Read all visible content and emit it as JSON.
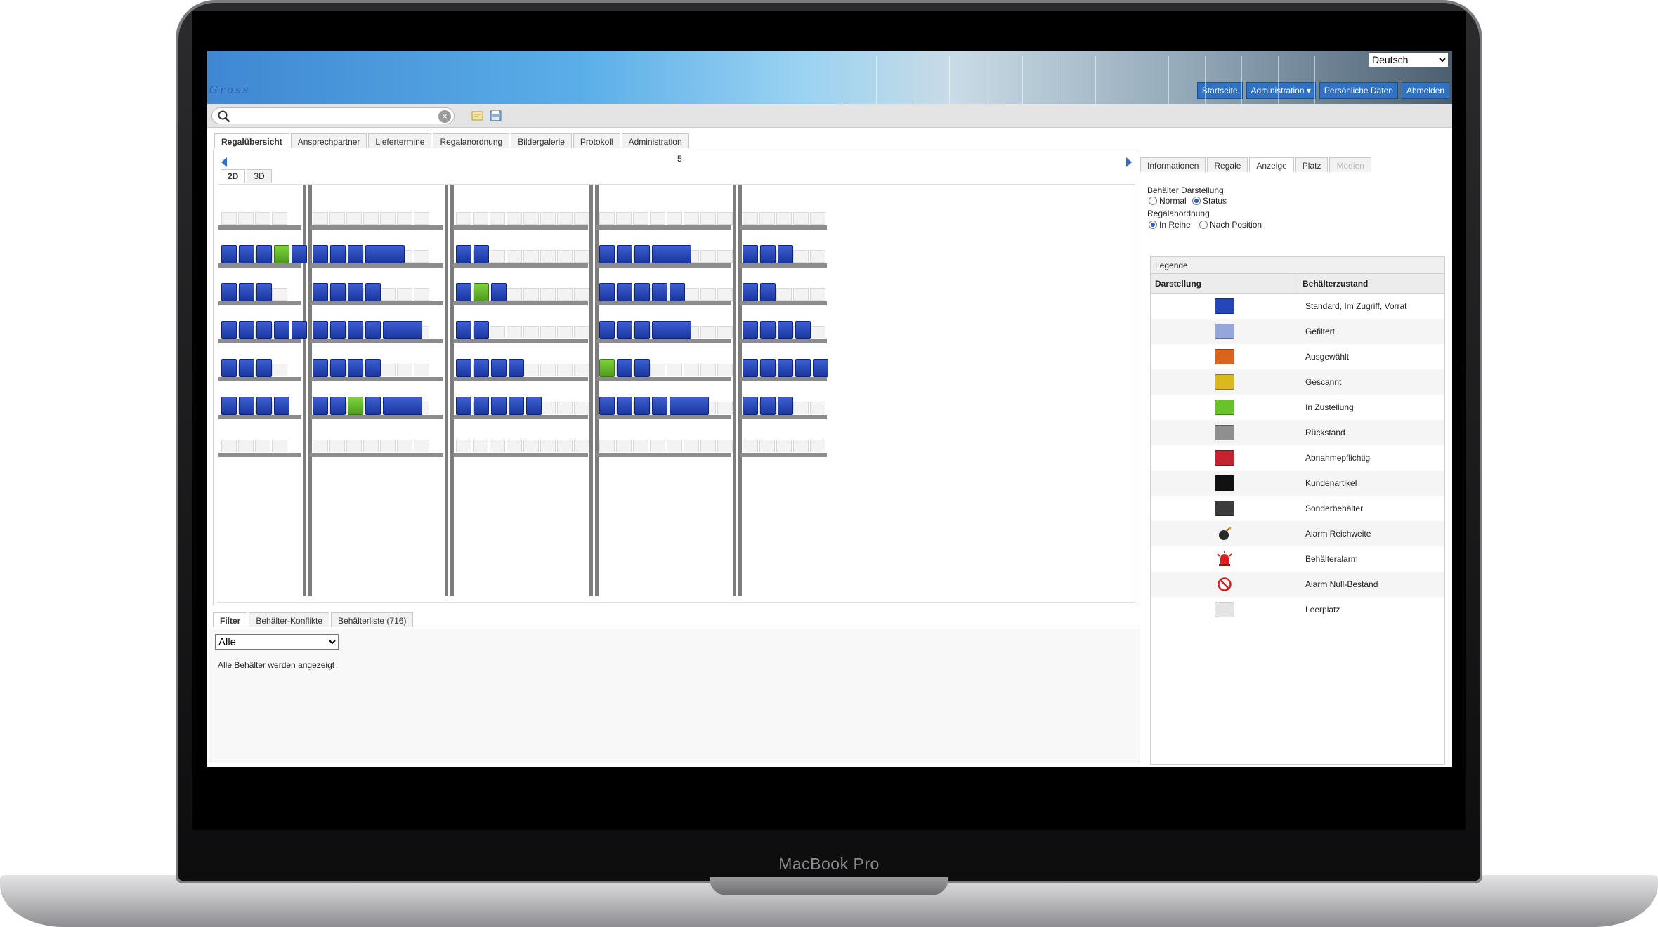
{
  "device": {
    "brand": "MacBook Pro"
  },
  "header": {
    "logo": "Gross",
    "language": {
      "selected": "Deutsch"
    },
    "nav": [
      {
        "label": "Startseite"
      },
      {
        "label": "Administration ▾"
      },
      {
        "label": "Persönliche Daten"
      },
      {
        "label": "Abmelden"
      }
    ]
  },
  "toolbar": {
    "search_value": "",
    "icons": [
      "search-icon",
      "clear-icon",
      "note-icon",
      "save-icon"
    ]
  },
  "main_tabs": [
    "Regalübersicht",
    "Ansprechpartner",
    "Liefertermine",
    "Regalanordnung",
    "Bildergalerie",
    "Protokoll",
    "Administration"
  ],
  "shelf_view": {
    "page": "5",
    "view_tabs": [
      "2D",
      "3D"
    ]
  },
  "bottom": {
    "tabs": [
      "Filter",
      "Behälter-Konflikte",
      "Behälterliste (716)"
    ],
    "filter_selected": "Alle",
    "filter_status": "Alle Behälter werden angezeigt"
  },
  "side": {
    "tabs": [
      "Informationen",
      "Regale",
      "Anzeige",
      "Platz",
      "Medien"
    ],
    "display_label": "Behälter Darstellung",
    "display_options": [
      "Normal",
      "Status"
    ],
    "display_selected": "Status",
    "order_label": "Regalanordnung",
    "order_options": [
      "In Reihe",
      "Nach Position"
    ],
    "order_selected": "In Reihe",
    "legend": {
      "title": "Legende",
      "col_display": "Darstellung",
      "col_state": "Behälterzustand",
      "rows": [
        {
          "label": "Standard, Im Zugriff, Vorrat",
          "color": "#2447b8",
          "icon": "bin-standard"
        },
        {
          "label": "Gefiltert",
          "color": "#95a6dc",
          "icon": "bin-filtered"
        },
        {
          "label": "Ausgewählt",
          "color": "#d8641e",
          "icon": "bin-selected"
        },
        {
          "label": "Gescannt",
          "color": "#d9b91c",
          "icon": "bin-scanned"
        },
        {
          "label": "In Zustellung",
          "color": "#66c42a",
          "icon": "bin-delivery"
        },
        {
          "label": "Rückstand",
          "color": "#8f8f8f",
          "icon": "bin-backlog"
        },
        {
          "label": "Abnahmepflichtig",
          "color": "#c5232f",
          "icon": "bin-acceptance"
        },
        {
          "label": "Kundenartikel",
          "color": "#111111",
          "icon": "bin-customer"
        },
        {
          "label": "Sonderbehälter",
          "color": "#3b3b3b",
          "icon": "bin-special"
        },
        {
          "label": "Alarm Reichweite",
          "color": "#2a2a2a",
          "icon": "bomb-icon"
        },
        {
          "label": "Behälteralarm",
          "color": "#d82020",
          "icon": "siren-icon"
        },
        {
          "label": "Alarm Null-Bestand",
          "color": "#d82020",
          "icon": "no-entry-icon"
        },
        {
          "label": "Leerplatz",
          "color": "#e4e4e4",
          "icon": "bin-empty"
        }
      ]
    }
  }
}
